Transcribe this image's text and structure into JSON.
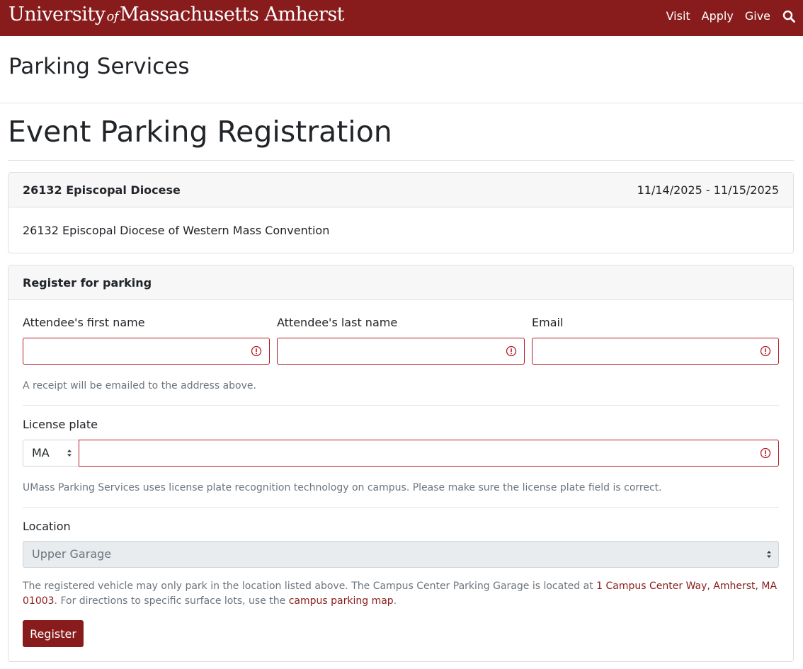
{
  "header": {
    "brand_part1": "University",
    "brand_of": "of",
    "brand_part2": "Massachusetts Amherst",
    "nav": [
      "Visit",
      "Apply",
      "Give"
    ],
    "search_icon": "search-icon",
    "color": "#881c1c"
  },
  "site_title": "Parking Services",
  "page_title": "Event Parking Registration",
  "event": {
    "name": "26132 Episcopal Diocese",
    "dates": "11/14/2025 - 11/15/2025",
    "description": "26132 Episcopal Diocese of Western Mass Convention"
  },
  "form": {
    "heading": "Register for parking",
    "first_name_label": "Attendee's first name",
    "last_name_label": "Attendee's last name",
    "email_label": "Email",
    "receipt_help": "A receipt will be emailed to the address above.",
    "plate_label": "License plate",
    "state_value": "MA",
    "plate_help": "UMass Parking Services uses license plate recognition technology on campus. Please make sure the license plate field is correct.",
    "location_label": "Location",
    "location_value": "Upper Garage",
    "location_help_1": "The registered vehicle may only park in the location listed above. The Campus Center Parking Garage is located at ",
    "location_link_address": "1 Campus Center Way, Amherst, MA 01003",
    "location_help_2": ". For directions to specific surface lots, use the ",
    "location_link_map": "campus parking map",
    "location_help_3": ".",
    "submit_label": "Register",
    "error_color": "#b31c27"
  }
}
